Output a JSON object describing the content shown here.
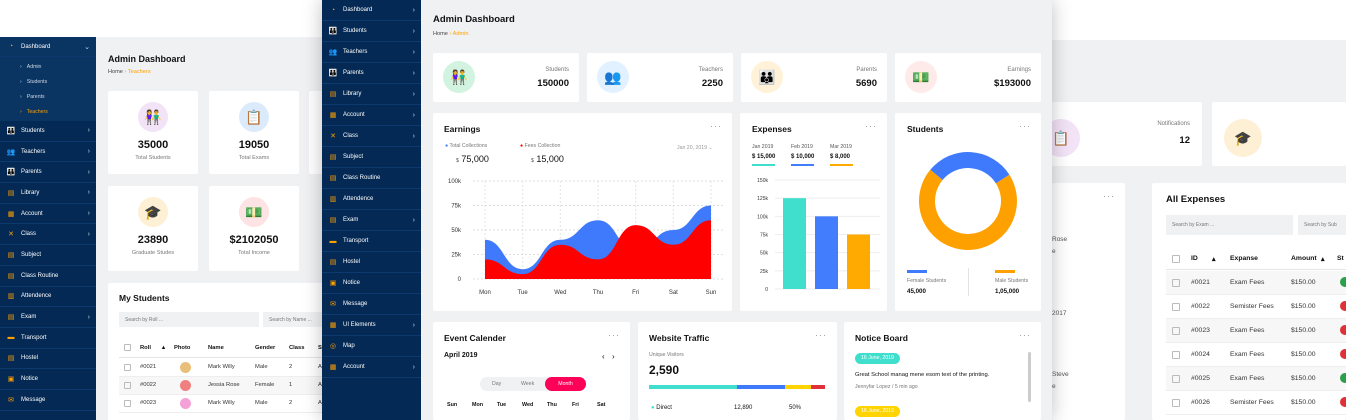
{
  "left": {
    "header": {
      "title": "Admin Dashboard",
      "crumb_home": "Home",
      "crumb_current": "Teachers"
    },
    "sidebar": {
      "top": "Dashboard",
      "subs": [
        "Admin",
        "Students",
        "Parents",
        "Teachers"
      ],
      "items": [
        "Students",
        "Teachers",
        "Parents",
        "Library",
        "Account",
        "Class",
        "Subject",
        "Class Routine",
        "Attendence",
        "Exam",
        "Transport",
        "Hostel",
        "Notice",
        "Message"
      ]
    },
    "stats": [
      {
        "value": "35000",
        "label": "Total Students"
      },
      {
        "value": "19050",
        "label": "Total Exams"
      },
      {
        "value": "23890",
        "label": "Graduate Studes"
      },
      {
        "value": "$2102050",
        "label": "Total Income"
      }
    ],
    "students": {
      "title": "My Students",
      "search_roll": "Search by Roll ...",
      "search_name": "Search by Name ...",
      "headers": [
        "Roll",
        "Photo",
        "Name",
        "Gender",
        "Class",
        "S"
      ],
      "rows": [
        {
          "roll": "#0021",
          "name": "Mark Willy",
          "gender": "Male",
          "class": "2",
          "extra": "A"
        },
        {
          "roll": "#0022",
          "name": "Jessia Rose",
          "gender": "Female",
          "class": "1",
          "extra": "A"
        },
        {
          "roll": "#0023",
          "name": "Mark Willy",
          "gender": "Male",
          "class": "2",
          "extra": "A"
        }
      ]
    }
  },
  "center": {
    "header": {
      "title": "Admin Dashboard",
      "crumb_home": "Home",
      "crumb_current": "Admin"
    },
    "sidebar": {
      "items": [
        "Dashboard",
        "Students",
        "Teachers",
        "Parents",
        "Library",
        "Account",
        "Class",
        "Subject",
        "Class Routine",
        "Attendence",
        "Exam",
        "Transport",
        "Hostel",
        "Notice",
        "Message",
        "UI Elements",
        "Map",
        "Account"
      ]
    },
    "stats": [
      {
        "label": "Students",
        "value": "150000"
      },
      {
        "label": "Teachers",
        "value": "2250"
      },
      {
        "label": "Parents",
        "value": "5690"
      },
      {
        "label": "Earnings",
        "value": "$193000"
      }
    ],
    "earnings": {
      "title": "Earnings",
      "legend1_label": "Total Collections",
      "legend1_value": "75,000",
      "legend2_label": "Fees Collection",
      "legend2_value": "15,000",
      "currency": "$",
      "date": "Jan 20, 2019",
      "colors": {
        "total": "#3f7afc",
        "fees": "#ff0000"
      }
    },
    "expenses": {
      "title": "Expenses",
      "months": [
        {
          "month": "Jan 2019",
          "value": "$ 15,000",
          "color": "#40dfcd"
        },
        {
          "month": "Feb 2019",
          "value": "$ 10,000",
          "color": "#417dfc"
        },
        {
          "month": "Mar 2019",
          "value": "$ 8,000",
          "color": "#ffaa01"
        }
      ]
    },
    "students_chart": {
      "title": "Students",
      "female_label": "Female Students",
      "female_value": "45,000",
      "male_label": "Male Students",
      "male_value": "1,05,000"
    },
    "calendar": {
      "title": "Event Calender",
      "month": "April 2019",
      "views": [
        "Day",
        "Week",
        "Month"
      ],
      "days": [
        "Sun",
        "Mon",
        "Tue",
        "Wed",
        "Thu",
        "Fri",
        "Sat"
      ]
    },
    "traffic": {
      "title": "Website Traffic",
      "subtitle": "Unique Visitors",
      "value": "2,590",
      "row": {
        "source": "Direct",
        "visitors": "12,890",
        "percent": "50%"
      }
    },
    "notice": {
      "title": "Notice Board",
      "items": [
        {
          "date": "16 June, 2019",
          "text": "Great School manag mene esom text of the printing.",
          "author": "Jennyfar Lopez",
          "time": "/ 5 min ago"
        },
        {
          "date": "16 June, 2019"
        }
      ]
    }
  },
  "right": {
    "notifications_label": "Notifications",
    "notifications_value": "12",
    "partial_texts": [
      "Rose",
      "e",
      "2017",
      "Steve",
      "e"
    ],
    "expenses": {
      "title": "All Expenses",
      "search_exam": "Search by Exam ...",
      "search_sub": "Search by Sub",
      "headers": [
        "ID",
        "Expanse",
        "Amount",
        "St"
      ],
      "rows": [
        {
          "id": "#0021",
          "type": "Exam Fees",
          "amount": "$150.00"
        },
        {
          "id": "#0022",
          "type": "Semister Fees",
          "amount": "$150.00"
        },
        {
          "id": "#0023",
          "type": "Exam Fees",
          "amount": "$150.00"
        },
        {
          "id": "#0024",
          "type": "Exam Fees",
          "amount": "$150.00"
        },
        {
          "id": "#0025",
          "type": "Exam Fees",
          "amount": "$150.00"
        },
        {
          "id": "#0026",
          "type": "Semister Fees",
          "amount": "$150.00"
        }
      ]
    }
  },
  "chart_data": [
    {
      "type": "area",
      "x": [
        "Mon",
        "Tue",
        "Wed",
        "Thu",
        "Fri",
        "Sat",
        "Sun"
      ],
      "ylim": [
        0,
        100000
      ],
      "yticks": [
        "0",
        "25k",
        "50k",
        "75k",
        "100k"
      ],
      "series": [
        {
          "name": "Total Collections",
          "values": [
            40000,
            10000,
            40000,
            60000,
            30000,
            50000,
            75000
          ]
        },
        {
          "name": "Fees Collection",
          "values": [
            20000,
            5000,
            35000,
            20000,
            55000,
            35000,
            60000
          ]
        }
      ]
    },
    {
      "type": "bar",
      "categories": [
        "Jan 2019",
        "Feb 2019",
        "Mar 2019"
      ],
      "values": [
        125000,
        100000,
        75000
      ],
      "yticks": [
        "0",
        "25k",
        "50k",
        "75k",
        "100k",
        "125k",
        "150k"
      ],
      "ylim": [
        0,
        150000
      ]
    },
    {
      "type": "pie",
      "series": [
        {
          "name": "Female Students",
          "values": [
            45000
          ]
        },
        {
          "name": "Male Students",
          "values": [
            105000
          ]
        }
      ]
    }
  ]
}
